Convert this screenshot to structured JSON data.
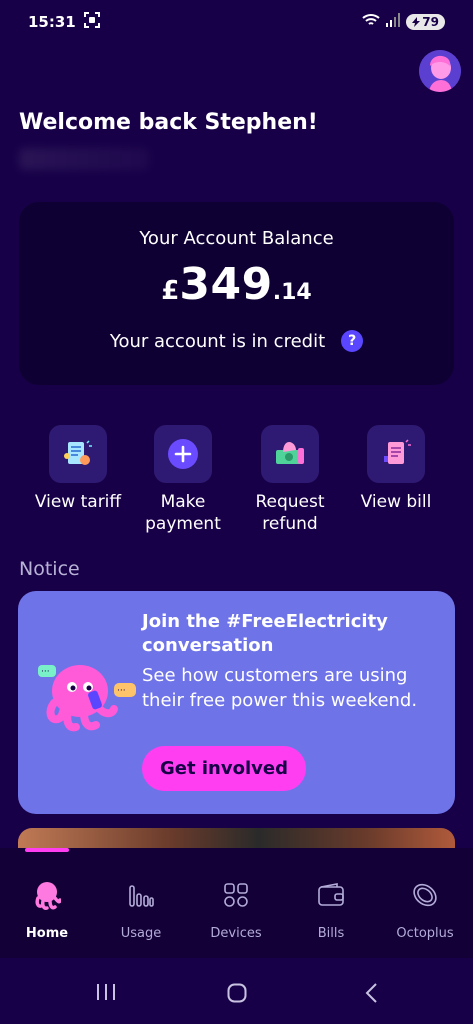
{
  "status_bar": {
    "time": "15:31",
    "battery": "79"
  },
  "greeting": "Welcome back Stephen!",
  "balance": {
    "label": "Your Account Balance",
    "currency": "£",
    "whole": "349",
    "fraction": ".14",
    "status": "Your account is in credit",
    "help": "?"
  },
  "actions": [
    {
      "label": "View tariff",
      "icon": "receipt-icon"
    },
    {
      "label": "Make payment",
      "icon": "plus-icon"
    },
    {
      "label": "Request refund",
      "icon": "refund-icon"
    },
    {
      "label": "View bill",
      "icon": "bill-icon"
    }
  ],
  "notice": {
    "title": "Notice",
    "heading": "Join the #FreeElectricity conversation",
    "body": "See how customers are using their free power this weekend.",
    "cta": "Get involved"
  },
  "tabs": [
    {
      "label": "Home",
      "active": true
    },
    {
      "label": "Usage"
    },
    {
      "label": "Devices"
    },
    {
      "label": "Bills"
    },
    {
      "label": "Octoplus"
    }
  ],
  "colors": {
    "background": "#180048",
    "card": "#0e0033",
    "notice_card": "#6f73e8",
    "accent_pink": "#ff3ef2",
    "help_badge": "#5b46ff"
  }
}
